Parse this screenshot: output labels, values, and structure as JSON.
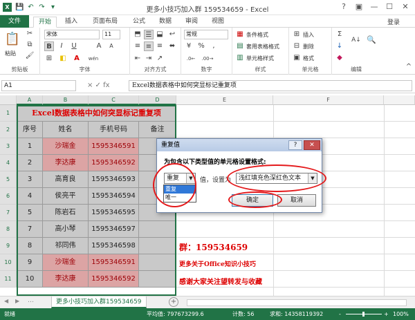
{
  "window": {
    "title": "更多小技巧加入群 159534659 - Excel",
    "login": "登录",
    "help": "?",
    "restore": "▣",
    "minimize": "—",
    "maximize": "☐",
    "close": "✕"
  },
  "quick_access": {
    "save": "💾",
    "undo": "↶",
    "redo": "↷",
    "customize": "▾"
  },
  "tabs": [
    "文件",
    "开始",
    "插入",
    "页面布局",
    "公式",
    "数据",
    "审阅",
    "视图"
  ],
  "ribbon": {
    "clipboard": {
      "paste": "粘贴",
      "label": "剪贴板"
    },
    "font": {
      "name": "宋体",
      "size": "11",
      "label": "字体",
      "bold": "B",
      "italic": "I",
      "underline": "U",
      "grow": "A",
      "shrink": "A",
      "color_letter": "A",
      "phonetic": "wén"
    },
    "alignment": {
      "label": "对齐方式"
    },
    "number": {
      "format": "常规",
      "label": "数字",
      "percent": "%",
      "comma": ",",
      "currency": "¥"
    },
    "styles": {
      "cond": "条件格式",
      "table": "套用表格格式",
      "cell": "单元格样式",
      "label": "样式"
    },
    "cells": {
      "insert": "插入",
      "delete": "删除",
      "format": "格式",
      "label": "单元格"
    },
    "editing": {
      "sum": "Σ",
      "fill": "↓",
      "clear": "◆",
      "sort": "A↓",
      "find": "🔍",
      "label": "编辑"
    },
    "collapse": "^"
  },
  "formula_bar": {
    "name_box": "A1",
    "fx": "× ✓ fx",
    "content": "Excel数据表格中如何突显标记重复项"
  },
  "columns": [
    "A",
    "B",
    "C",
    "D",
    "E",
    "F"
  ],
  "rows": [
    "1",
    "2",
    "3",
    "4",
    "5",
    "6",
    "7",
    "8",
    "9",
    "10",
    "11"
  ],
  "table": {
    "title": "Excel数据表格中如何突显标记重复项",
    "headers": [
      "序号",
      "姓名",
      "手机号码",
      "备注"
    ],
    "data": [
      [
        "1",
        "沙瑞金",
        "1595346591",
        ""
      ],
      [
        "2",
        "李达康",
        "1595346592",
        ""
      ],
      [
        "3",
        "高育良",
        "1595346593",
        ""
      ],
      [
        "4",
        "侯亮平",
        "1595346594",
        ""
      ],
      [
        "5",
        "陈岩石",
        "1595346595",
        ""
      ],
      [
        "7",
        "高小琴",
        "1595346597",
        ""
      ],
      [
        "8",
        "祁同伟",
        "1595346598",
        ""
      ],
      [
        "9",
        "沙瑞金",
        "1595346591",
        ""
      ],
      [
        "10",
        "李达康",
        "1595346592",
        ""
      ]
    ],
    "duplicate_rows": [
      0,
      1,
      7,
      8
    ]
  },
  "annotations": {
    "group": "群：159534659",
    "tips": "更多关于Office知识小技巧",
    "thanks": "感谢大家关注望转发与收藏"
  },
  "dialog": {
    "title": "重复值",
    "help": "?",
    "close": "✕",
    "prompt": "为包含以下类型值的单元格设置格式:",
    "type_value": "重复",
    "mid_label": "值，设置为",
    "format_value": "浅红填充色深红色文本",
    "options": [
      "重复",
      "唯一"
    ],
    "ok": "确定",
    "cancel": "取消",
    "arrow": "▼"
  },
  "sheet": {
    "tab": "更多小技巧加入群159534659",
    "add": "+",
    "nav_prev": "◀",
    "nav_next": "▶",
    "more": "…"
  },
  "status": {
    "ready": "就绪",
    "average": "平均值: 797673299.6",
    "count": "计数: 56",
    "sum": "求和: 14358119392",
    "zoom": "100%",
    "minus": "-",
    "plus": "+"
  },
  "colors": {
    "accent": "#217346",
    "duplicate_fill": "#dca4a4",
    "duplicate_text": "#9c0006",
    "highlight_red": "#dd0000",
    "ring": "#e4191b"
  }
}
